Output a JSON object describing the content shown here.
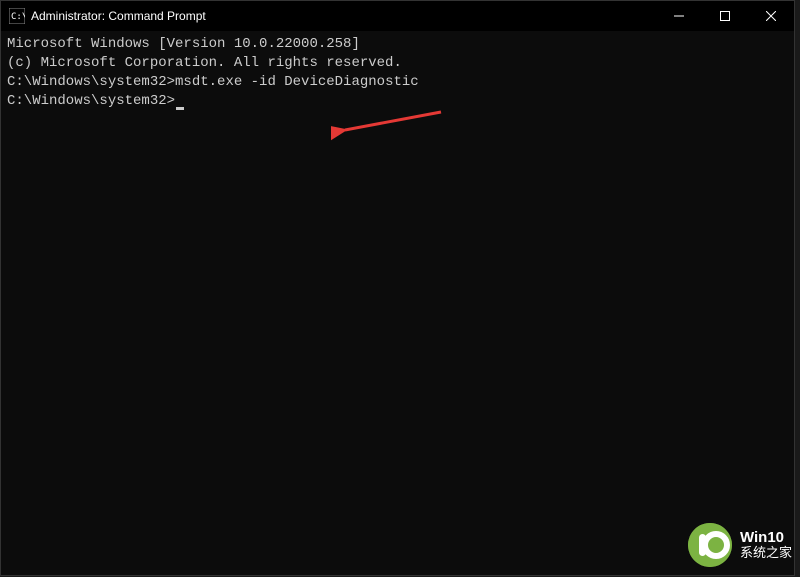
{
  "titlebar": {
    "title": "Administrator: Command Prompt"
  },
  "terminal": {
    "line1": "Microsoft Windows [Version 10.0.22000.258]",
    "line2": "(c) Microsoft Corporation. All rights reserved.",
    "blank1": "",
    "prompt1": "C:\\Windows\\system32>",
    "command1": "msdt.exe -id DeviceDiagnostic",
    "blank2": "",
    "prompt2": "C:\\Windows\\system32>"
  },
  "watermark": {
    "brand_top": "Win10",
    "brand_bottom": "系统之家"
  }
}
